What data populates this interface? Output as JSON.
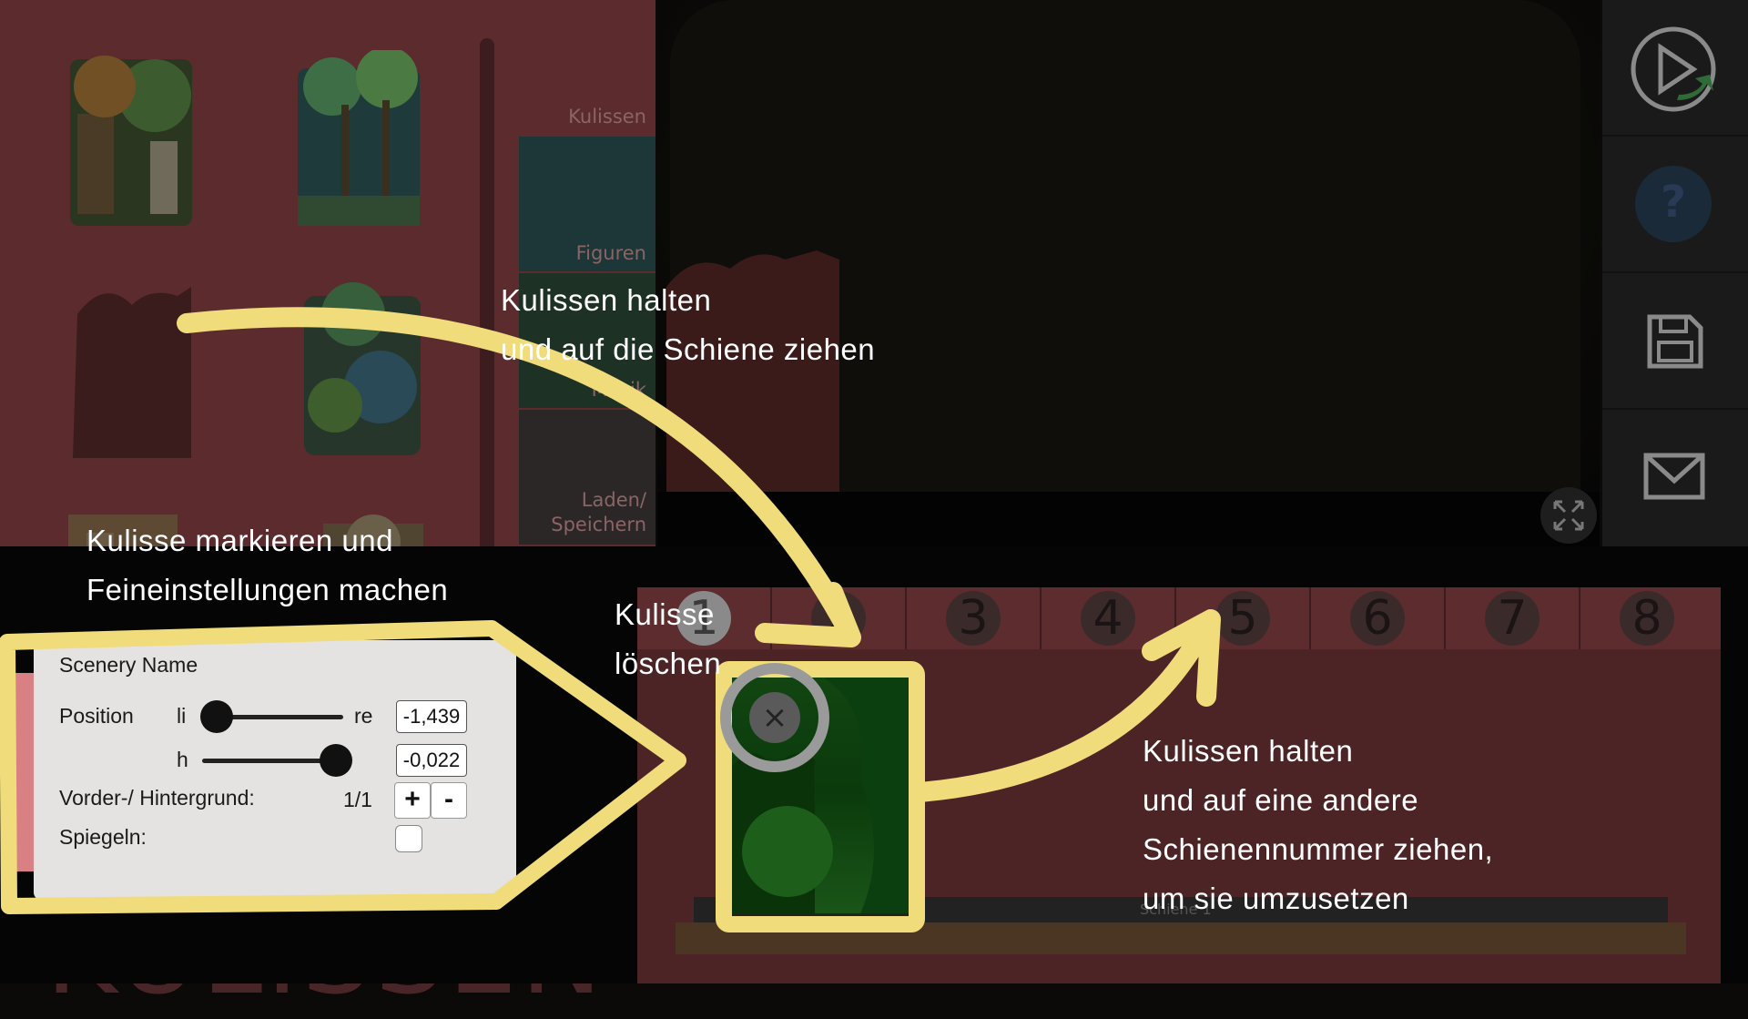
{
  "library": {
    "title": "KULISSEN",
    "thumbnails": [
      {
        "name": "jungle-temple"
      },
      {
        "name": "palm-grove"
      },
      {
        "name": "palm-silhouette"
      },
      {
        "name": "palm-bush"
      },
      {
        "name": "ruins-left"
      },
      {
        "name": "pavilion"
      }
    ]
  },
  "tabs": [
    {
      "label": "Kulissen"
    },
    {
      "label": "Figuren"
    },
    {
      "label": "Musik"
    },
    {
      "label": "Laden/\nSpeichern",
      "line1": "Laden/",
      "line2": "Speichern"
    }
  ],
  "sidebar": {
    "icons": [
      "play-icon",
      "help-icon",
      "save-icon",
      "mail-icon"
    ],
    "help_glyph": "?"
  },
  "rails": {
    "numbers": [
      "1",
      "2",
      "3",
      "4",
      "5",
      "6",
      "7",
      "8"
    ],
    "active": "1",
    "track_label": "Schiene 1"
  },
  "props": {
    "title": "Scenery Name",
    "position_label": "Position",
    "left_label": "li",
    "right_label": "re",
    "height_label": "h",
    "x_value": "-1,439",
    "y_value": "-0,022",
    "x_slider_fraction": 0.1,
    "y_slider_fraction": 0.95,
    "layer_label": "Vorder-/ Hintergrund:",
    "layer_value": "1/1",
    "plus": "+",
    "minus": "-",
    "mirror_label": "Spiegeln:",
    "mirror_checked": false
  },
  "delete_glyph": "×",
  "tips": {
    "drag_to_rail": [
      "Kulissen halten",
      "und auf die Schiene ziehen"
    ],
    "mark_and_adjust": [
      "Kulisse markieren und",
      "Feineinstellungen machen"
    ],
    "delete": [
      "Kulisse",
      "löschen"
    ],
    "move_rail": [
      "Kulissen halten",
      "und auf eine andere",
      "Schienennummer ziehen,",
      "um sie umzusetzen"
    ]
  },
  "colors": {
    "highlight": "#f0dc7a",
    "panel": "#5c2b2e",
    "accent_pink": "#d98084"
  }
}
